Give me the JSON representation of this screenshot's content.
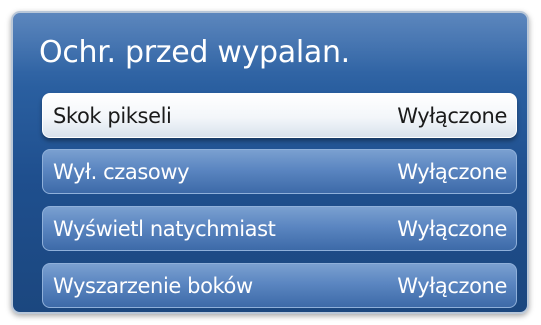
{
  "menu": {
    "title": "Ochr. przed wypalan.",
    "items": [
      {
        "label": "Skok pikseli",
        "value": "Wyłączone",
        "selected": true
      },
      {
        "label": "Wył. czasowy",
        "value": "Wyłączone",
        "selected": false
      },
      {
        "label": "Wyświetl natychmiast",
        "value": "Wyłączone",
        "selected": false
      },
      {
        "label": "Wyszarzenie boków",
        "value": "Wyłączone",
        "selected": false
      }
    ]
  },
  "colors": {
    "panel_background": "#2a5fa0",
    "selected_row": "#ffffff",
    "normal_row": "#5b86c1"
  }
}
